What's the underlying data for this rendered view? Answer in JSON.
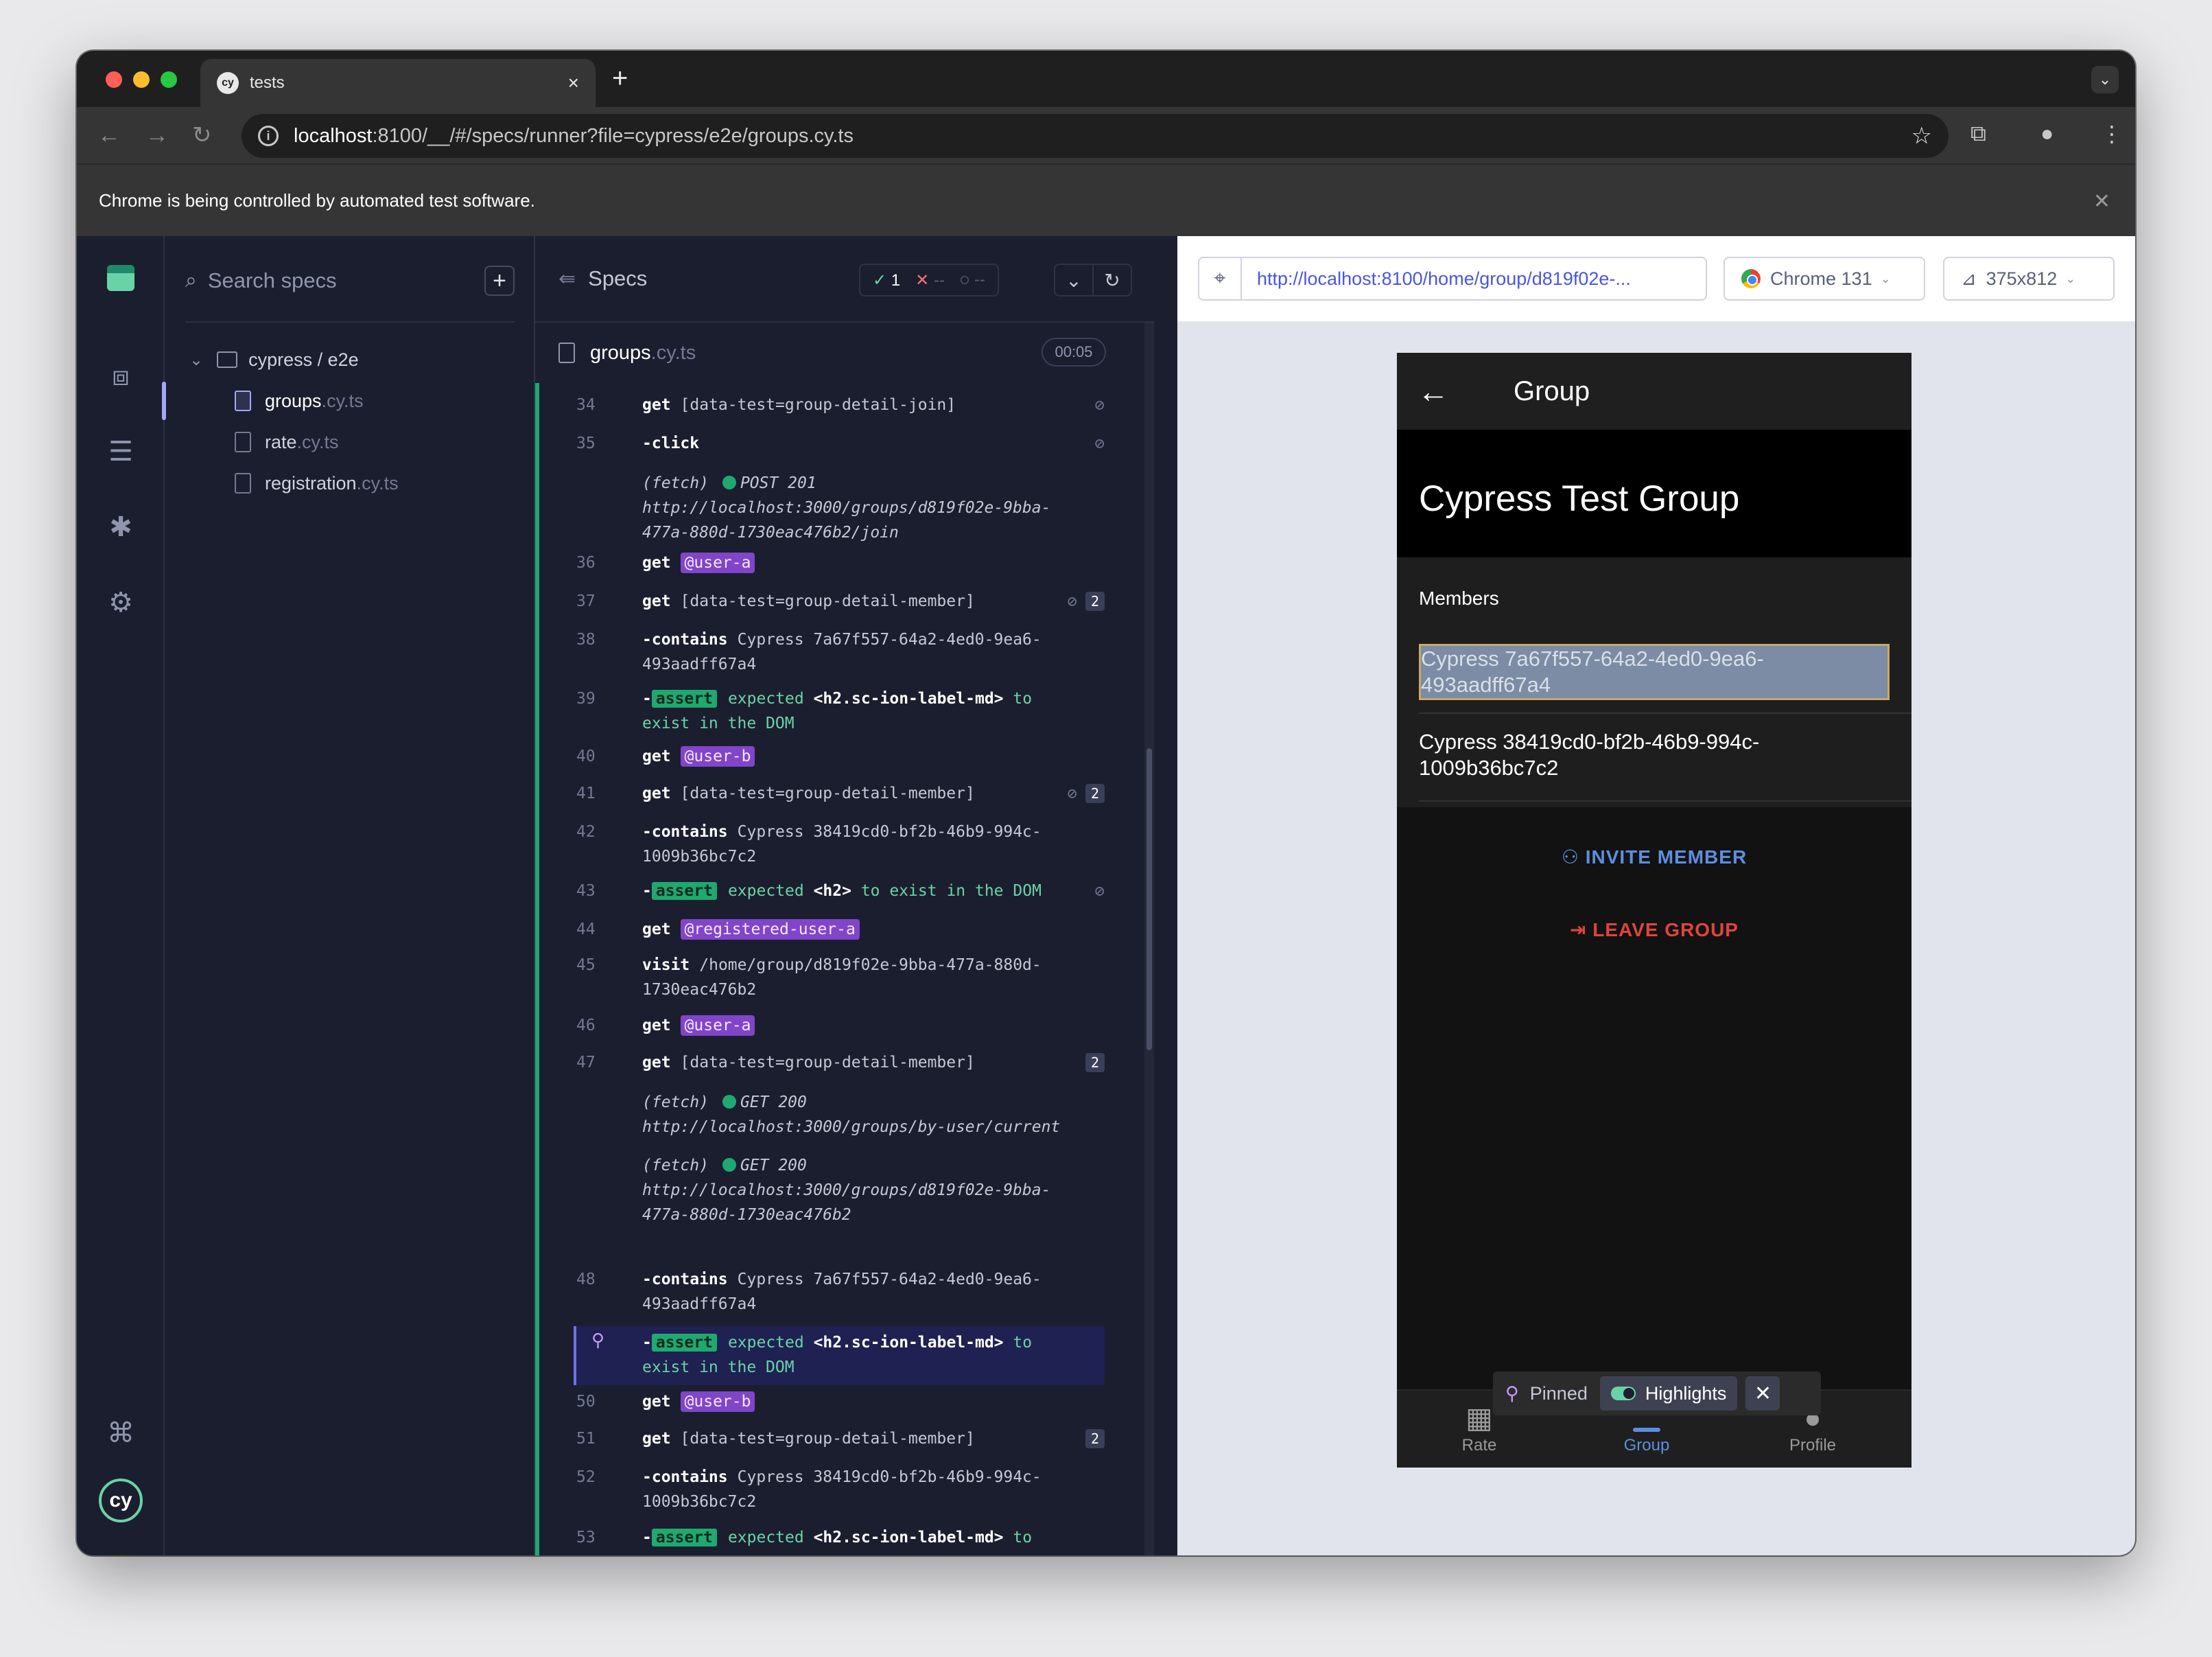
{
  "browser": {
    "tab_title": "tests",
    "tab_favicon": "cy",
    "address_host": "localhost",
    "address_rest": ":8100/__/#/specs/runner?file=cypress/e2e/groups.cy.ts",
    "infobar_text": "Chrome is being controlled by automated test software."
  },
  "specs_panel": {
    "search_placeholder": "Search specs",
    "folder": "cypress / e2e",
    "files": [
      {
        "name": "groups",
        "ext": ".cy.ts"
      },
      {
        "name": "rate",
        "ext": ".cy.ts"
      },
      {
        "name": "registration",
        "ext": ".cy.ts"
      }
    ]
  },
  "reporter": {
    "title": "Specs",
    "stats": {
      "passed": "1",
      "failed": "--",
      "pending": "--"
    },
    "spec_name": "groups",
    "spec_ext": ".cy.ts",
    "duration": "00:05",
    "commands": [
      {
        "num": "34",
        "name": "get",
        "msg": "[data-test=group-detail-join]"
      },
      {
        "num": "35",
        "name": "-click",
        "msg": ""
      },
      {
        "fetch": "(fetch)",
        "method": "POST 201",
        "url1": "http://localhost:3000/groups/d819f02e-9bba-",
        "url2": "477a-880d-1730eac476b2/join"
      },
      {
        "num": "36",
        "name": "get",
        "alias": "@user-a"
      },
      {
        "num": "37",
        "name": "get",
        "msg": "[data-test=group-detail-member]",
        "badge": "2"
      },
      {
        "num": "38",
        "name": "-contains",
        "msg1": "Cypress 7a67f557-64a2-4ed0-9ea6-",
        "msg2": "493aadff67a4"
      },
      {
        "num": "39",
        "assert": "assert",
        "l1a": "expected ",
        "l1b": "<h2.sc-ion-label-md>",
        "l1c": " to",
        "l2": "exist in the DOM"
      },
      {
        "num": "40",
        "name": "get",
        "alias": "@user-b"
      },
      {
        "num": "41",
        "name": "get",
        "msg": "[data-test=group-detail-member]",
        "badge": "2"
      },
      {
        "num": "42",
        "name": "-contains",
        "msg1": "Cypress 38419cd0-bf2b-46b9-994c-",
        "msg2": "1009b36bc7c2"
      },
      {
        "num": "43",
        "assert": "assert",
        "l1a": "expected ",
        "l1b": "<h2>",
        "l1c": " to exist in the DOM"
      },
      {
        "num": "44",
        "name": "get",
        "alias": "@registered-user-a"
      },
      {
        "num": "45",
        "name": "visit",
        "msg1": "/home/group/d819f02e-9bba-477a-880d-",
        "msg2": "1730eac476b2"
      },
      {
        "num": "46",
        "name": "get",
        "alias": "@user-a"
      },
      {
        "num": "47",
        "name": "get",
        "msg": "[data-test=group-detail-member]",
        "badge": "2"
      },
      {
        "fetch": "(fetch)",
        "method": "GET 200",
        "url1": "http://localhost:3000/groups/by-user/current"
      },
      {
        "fetch": "(fetch)",
        "method": "GET 200",
        "url1": "http://localhost:3000/groups/d819f02e-9bba-",
        "url2": "477a-880d-1730eac476b2"
      },
      {
        "num": "48",
        "name": "-contains",
        "msg1": "Cypress 7a67f557-64a2-4ed0-9ea6-",
        "msg2": "493aadff67a4"
      },
      {
        "num": "",
        "assert": "assert",
        "l1a": "expected ",
        "l1b": "<h2.sc-ion-label-md>",
        "l1c": " to",
        "l2": "exist in the DOM"
      },
      {
        "num": "50",
        "name": "get",
        "alias": "@user-b"
      },
      {
        "num": "51",
        "name": "get",
        "msg": "[data-test=group-detail-member]",
        "badge": "2"
      },
      {
        "num": "52",
        "name": "-contains",
        "msg1": "Cypress 38419cd0-bf2b-46b9-994c-",
        "msg2": "1009b36bc7c2"
      },
      {
        "num": "53",
        "assert": "assert",
        "l1a": "expected ",
        "l1b": "<h2.sc-ion-label-md>",
        "l1c": " to"
      }
    ]
  },
  "aut": {
    "url": "http://localhost:8100/home/group/d819f02e-...",
    "browser_label": "Chrome 131",
    "viewport_label": "375x812",
    "phone": {
      "toolbar_title": "Group",
      "group_name": "Cypress Test Group",
      "members_label": "Members",
      "member_1_l1": "Cypress 7a67f557-64a2-4ed0-9ea6-",
      "member_1_l2": "493aadff67a4",
      "member_2_l1": "Cypress 38419cd0-bf2b-46b9-994c-",
      "member_2_l2": "1009b36bc7c2",
      "invite_label": "INVITE MEMBER",
      "leave_label": "LEAVE GROUP",
      "tabs": [
        "Rate",
        "Group",
        "Profile"
      ]
    },
    "pin_toolbar": {
      "pinned_label": "Pinned",
      "highlights_label": "Highlights"
    }
  }
}
